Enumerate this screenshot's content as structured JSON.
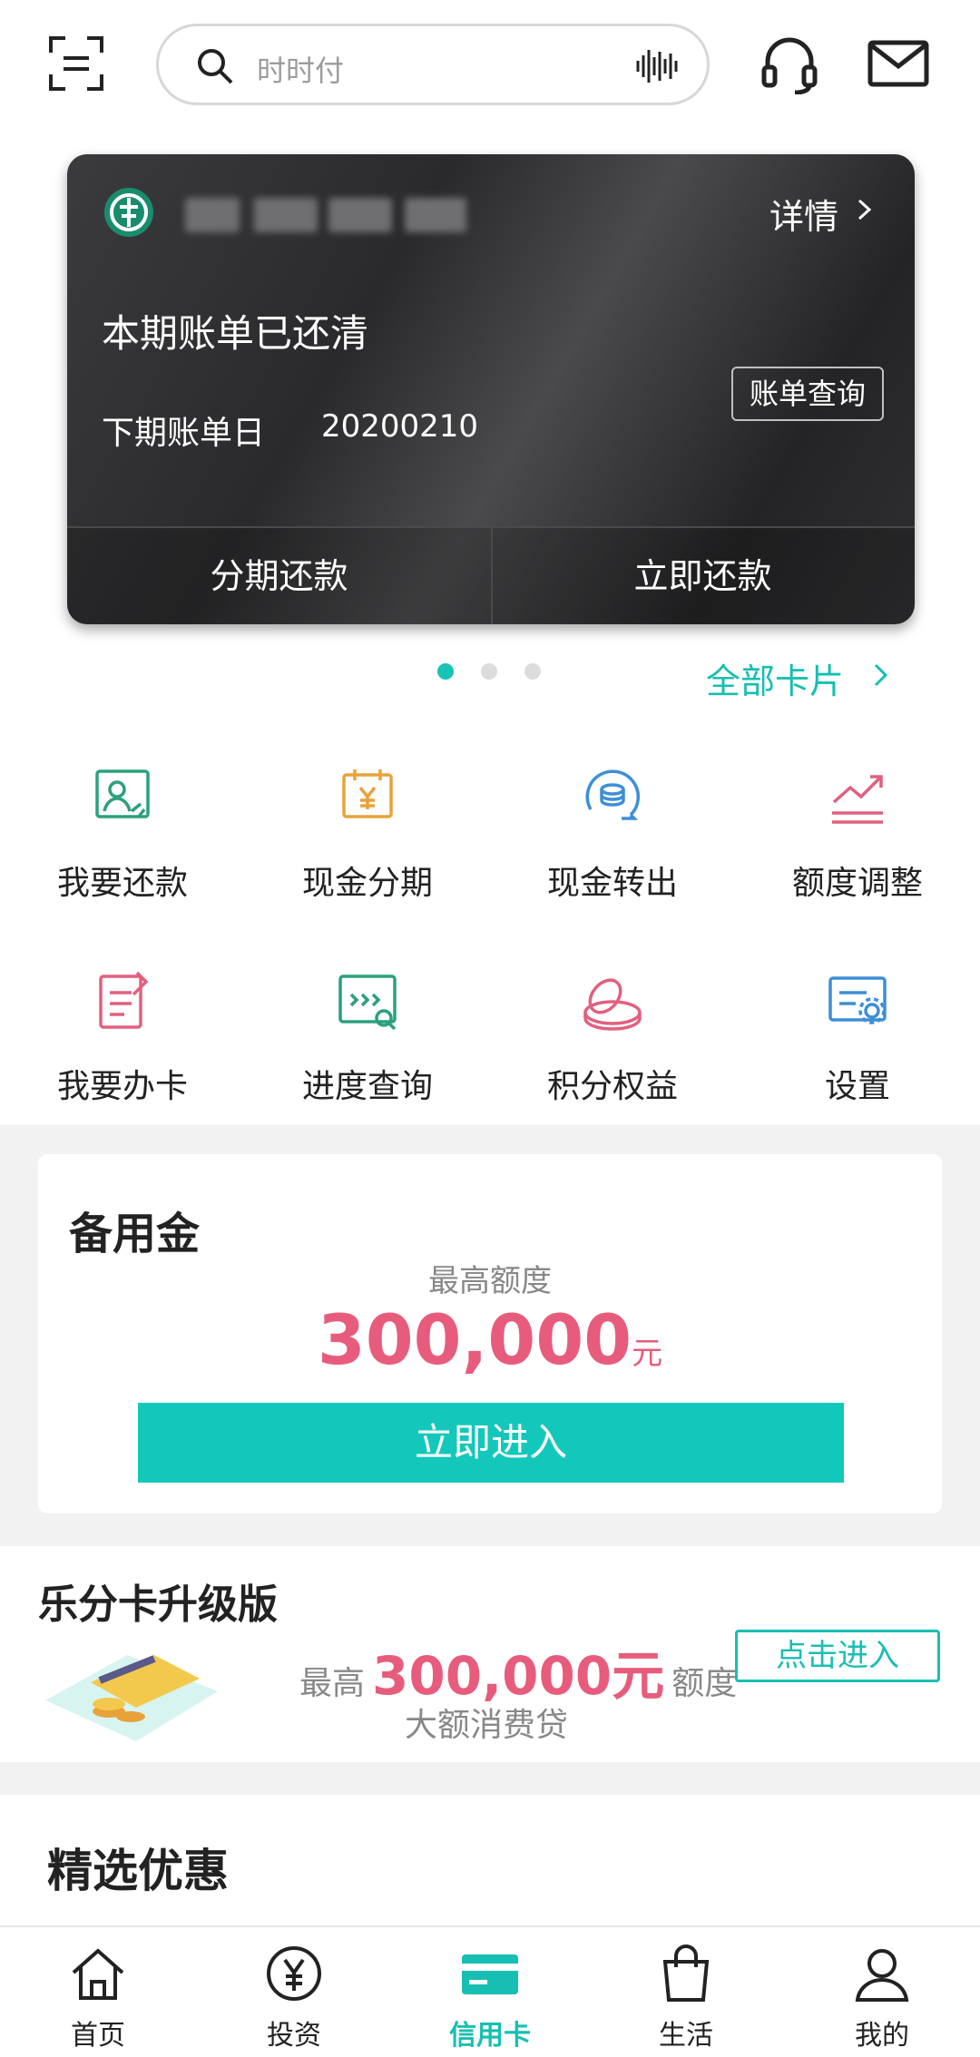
{
  "search": {
    "placeholder": "时时付"
  },
  "card": {
    "detail_label": "详情",
    "status": "本期账单已还清",
    "bill_query": "账单查询",
    "next_bill_label": "下期账单日",
    "next_bill_value": "20200210",
    "installment_label": "分期还款",
    "repay_now_label": "立即还款"
  },
  "carousel": {
    "pages": 3,
    "active": 1
  },
  "all_cards_label": "全部卡片",
  "grid": [
    {
      "label": "我要还款",
      "icon": "repay-icon",
      "color": "#2ba07c"
    },
    {
      "label": "现金分期",
      "icon": "cash-installment-icon",
      "color": "#e8a23a"
    },
    {
      "label": "现金转出",
      "icon": "cash-transfer-icon",
      "color": "#3d8fd6"
    },
    {
      "label": "额度调整",
      "icon": "limit-adjust-icon",
      "color": "#e2607f"
    },
    {
      "label": "我要办卡",
      "icon": "apply-card-icon",
      "color": "#e2607f"
    },
    {
      "label": "进度查询",
      "icon": "progress-query-icon",
      "color": "#2ba07c"
    },
    {
      "label": "积分权益",
      "icon": "points-icon",
      "color": "#e2607f"
    },
    {
      "label": "设置",
      "icon": "settings-icon",
      "color": "#3d8fd6"
    }
  ],
  "reserve": {
    "title": "备用金",
    "subtitle": "最高额度",
    "amount": "300,000",
    "unit": "元",
    "enter_label": "立即进入"
  },
  "lefen": {
    "title": "乐分卡升级版",
    "prefix": "最高",
    "amount": "300,000元",
    "suffix": "额度",
    "desc": "大额消费贷",
    "enter_label": "点击进入"
  },
  "promo": {
    "title": "精选优惠"
  },
  "tabs": [
    {
      "label": "首页",
      "icon": "home-icon"
    },
    {
      "label": "投资",
      "icon": "yuan-icon"
    },
    {
      "label": "信用卡",
      "icon": "credit-card-icon",
      "active": true
    },
    {
      "label": "生活",
      "icon": "shopping-bag-icon"
    },
    {
      "label": "我的",
      "icon": "user-icon"
    }
  ],
  "colors": {
    "accent": "#16bfb2",
    "highlight": "#e75c7c"
  }
}
